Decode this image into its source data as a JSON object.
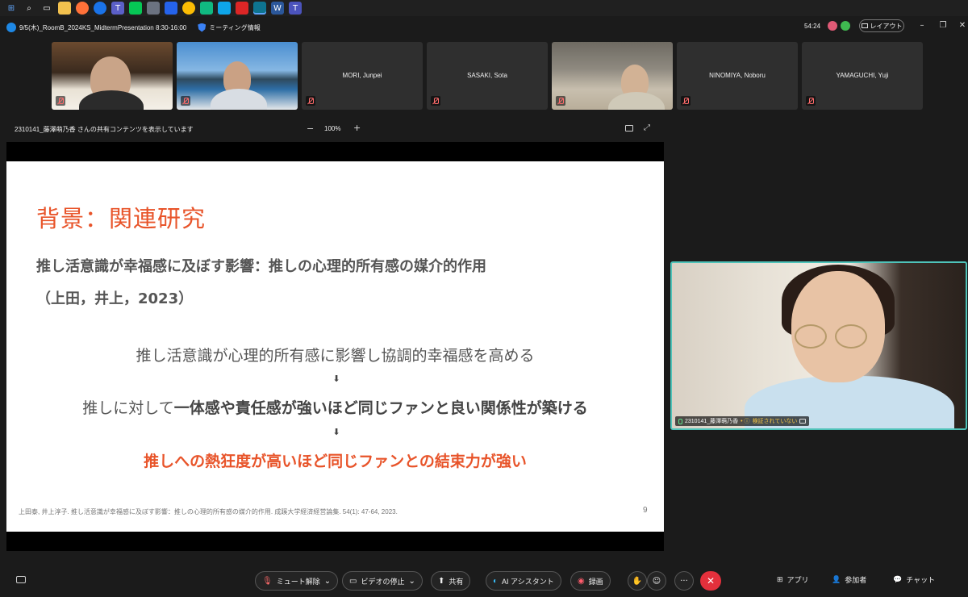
{
  "window": {
    "title": "9/5(木)_RoomB_2024KS_MidtermPresentation 8:30-16:00",
    "meeting_info": "ミーティング情報",
    "elapsed": "54:24",
    "layout_label": "レイアウト",
    "minimize": "–",
    "restore": "❐",
    "close": "✕"
  },
  "participants": [
    {
      "name": "",
      "has_video": true
    },
    {
      "name": "",
      "has_video": true
    },
    {
      "name": "MORI, Junpei",
      "has_video": false
    },
    {
      "name": "SASAKI, Sota",
      "has_video": false
    },
    {
      "name": "",
      "has_video": true
    },
    {
      "name": "NINOMIYA, Noboru",
      "has_video": false
    },
    {
      "name": "YAMAGUCHI, Yuji",
      "has_video": false
    }
  ],
  "share": {
    "header": "2310141_藤澤萌乃香 さんの共有コンテンツを表示しています",
    "zoom_minus": "−",
    "zoom": "100%",
    "zoom_plus": "+"
  },
  "slide": {
    "title": "背景：関連研究",
    "subtitle_line1": "推し活意識が幸福感に及ぼす影響：推しの心理的所有感の媒介的作用",
    "subtitle_line2": "（上田，井上，2023）",
    "point1": "推し活意識が心理的所有感に影響し協調的幸福感を高める",
    "arrow": "⬇",
    "point2_prefix": "推しに対して",
    "point2_bold": "一体感や責任感が強いほど同じファンと良い関係性が築ける",
    "point3": "推しへの熱狂度が高いほど同じファンとの結束力が強い",
    "citation": "上田泰, 井上淳子. 推し活意識が幸福感に及ぼす影響：推しの心理的所有感の媒介的作用. 成蹊大学経済経営論集. 54(1): 47-64, 2023.",
    "page": "9"
  },
  "speaker": {
    "name": "2310141_藤澤萌乃香",
    "status": "検証されていない"
  },
  "controls": {
    "unmute": "ミュート解除",
    "stop_video": "ビデオの停止",
    "share": "共有",
    "ai_assistant": "AI アシスタント",
    "record": "録画",
    "more": "···",
    "apps": "アプリ",
    "participants": "参加者",
    "chat": "チャット"
  },
  "colors": {
    "accent_orange": "#e8542a",
    "speaker_border": "#4fc3b9",
    "leave_red": "#e3303c"
  }
}
